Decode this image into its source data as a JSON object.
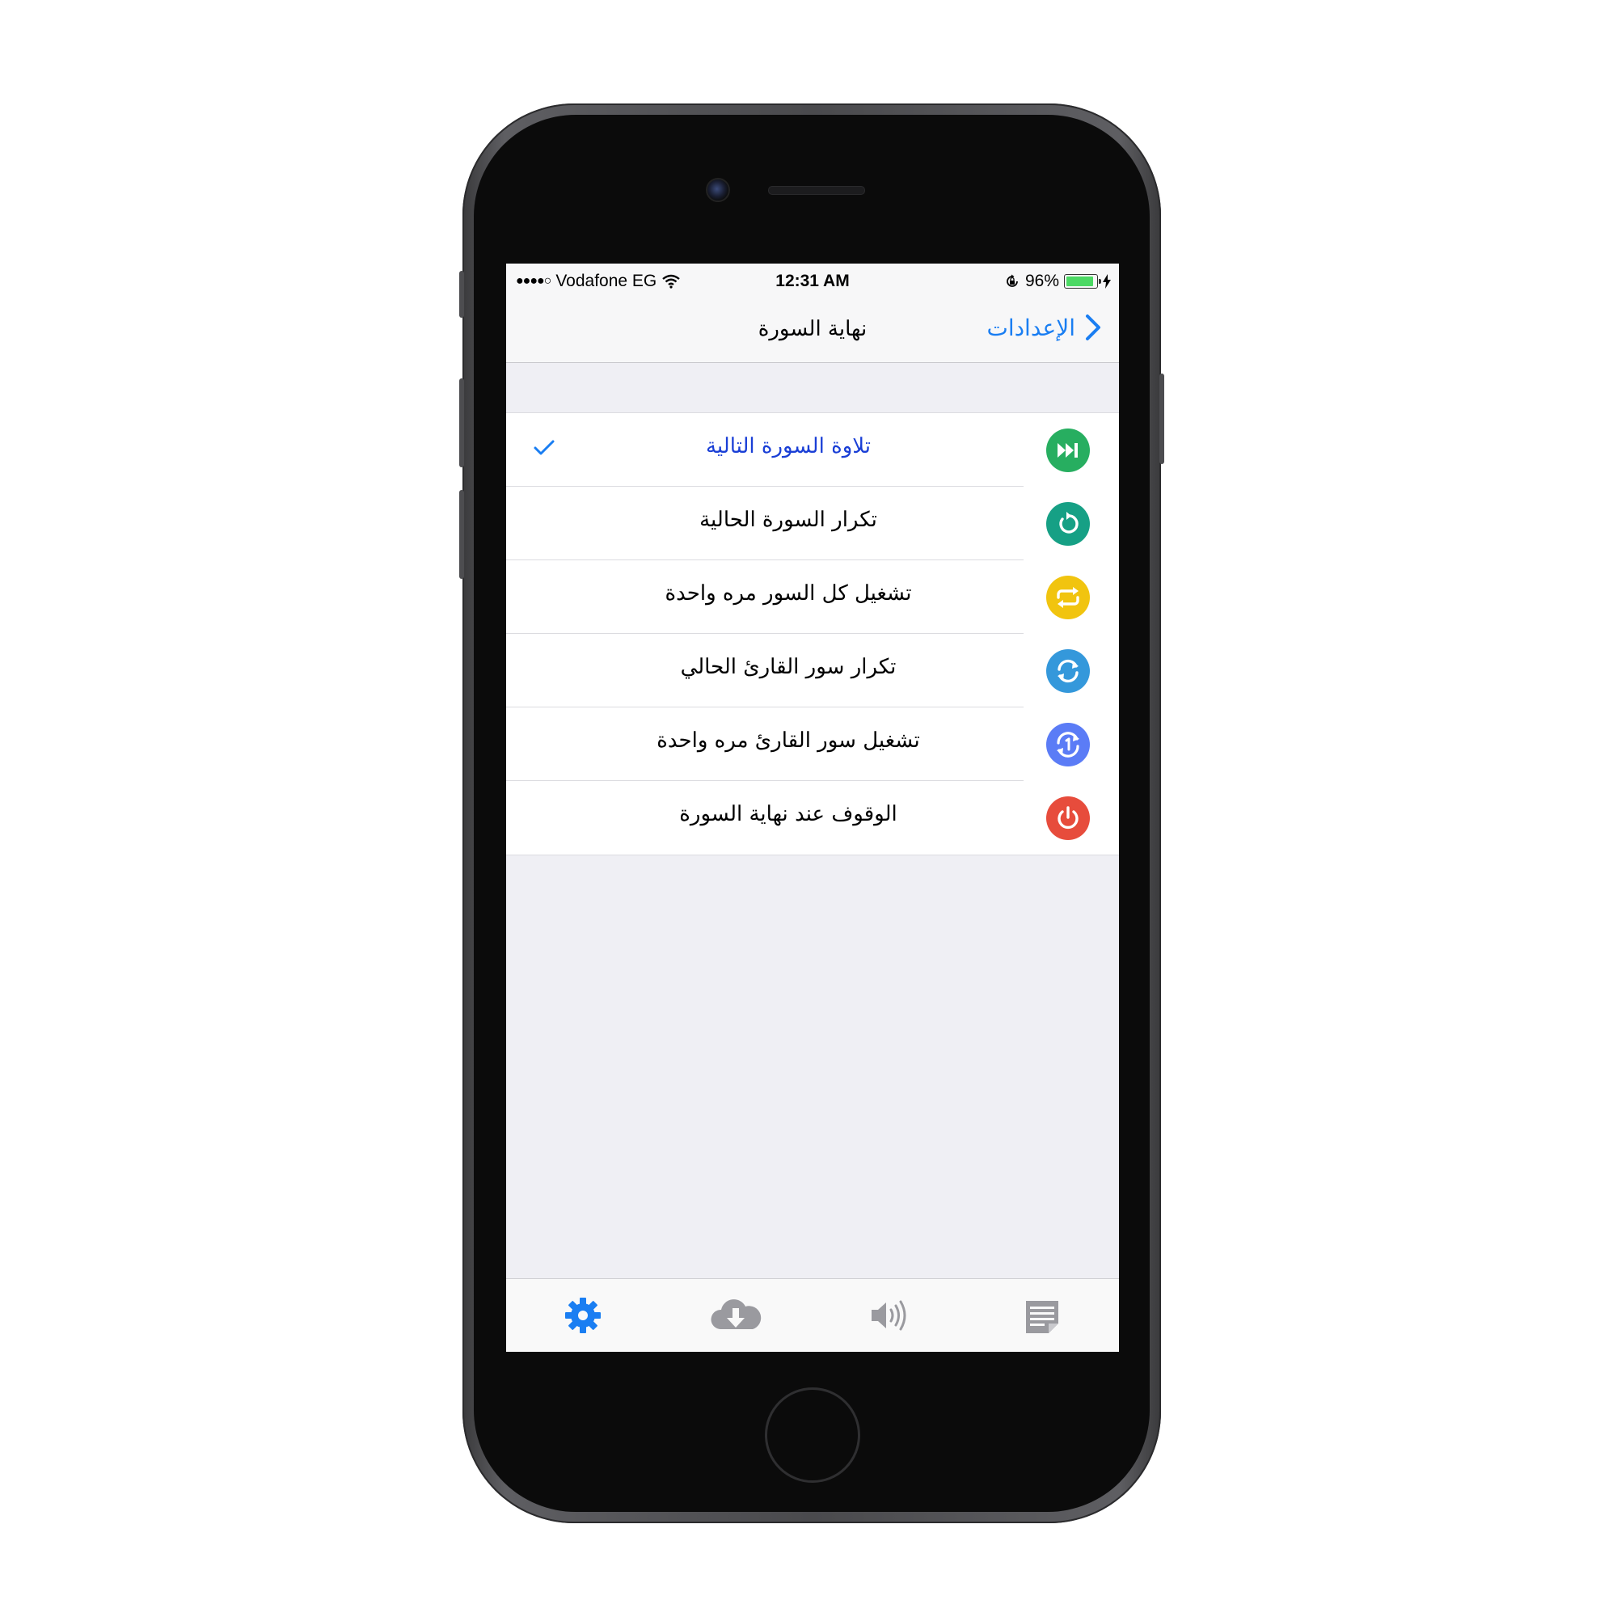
{
  "status_bar": {
    "carrier": "Vodafone EG",
    "signal_glyph": "●●●●○",
    "time": "12:31 AM",
    "battery_percent_label": "96%",
    "battery_level": 0.96
  },
  "nav": {
    "title": "نهاية السورة",
    "back_label": "الإعدادات"
  },
  "options": [
    {
      "label": "تلاوة السورة التالية",
      "selected": true,
      "icon": "fast-forward-icon",
      "color": "#27ae60"
    },
    {
      "label": "تكرار السورة الحالية",
      "selected": false,
      "icon": "undo-arrow-icon",
      "color": "#16a085"
    },
    {
      "label": "تشغيل كل السور مره واحدة",
      "selected": false,
      "icon": "repeat-icon",
      "color": "#f1c40f"
    },
    {
      "label": "تكرار سور القارئ الحالي",
      "selected": false,
      "icon": "refresh-icon",
      "color": "#3498db"
    },
    {
      "label": "تشغيل سور القارئ مره واحدة",
      "selected": false,
      "icon": "repeat-once-icon",
      "color": "#5b7cf6"
    },
    {
      "label": "الوقوف عند نهاية السورة",
      "selected": false,
      "icon": "power-icon",
      "color": "#e74c3c"
    }
  ],
  "tabs": [
    {
      "icon": "gear-icon",
      "active": true
    },
    {
      "icon": "cloud-download-icon",
      "active": false
    },
    {
      "icon": "speaker-icon",
      "active": false
    },
    {
      "icon": "notes-icon",
      "active": false
    }
  ],
  "colors": {
    "accent": "#1a7ef2",
    "selected_text": "#1a3fd6",
    "background": "#efeff4",
    "inactive_tab": "#9a9a9f"
  }
}
